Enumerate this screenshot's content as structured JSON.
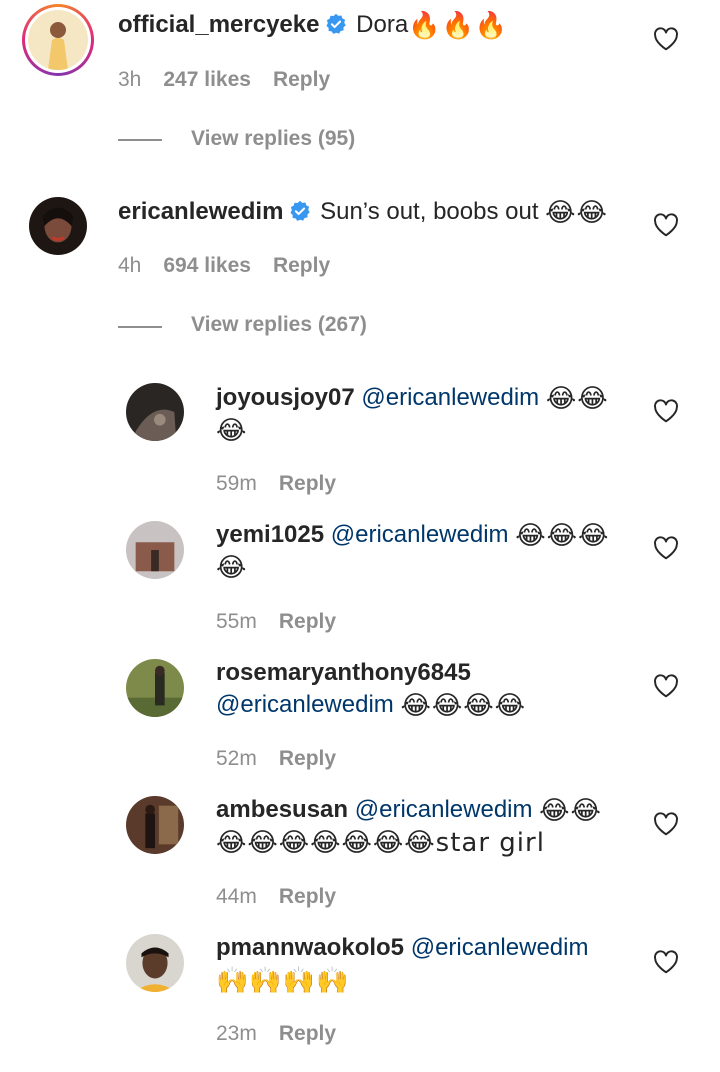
{
  "comments": [
    {
      "username": "official_mercyeke",
      "verified": true,
      "text": "Dora",
      "emoji": "🔥🔥🔥",
      "time": "3h",
      "likes": "247 likes",
      "reply": "Reply",
      "view_replies": "View replies (95)",
      "avatar_colors": [
        "#f3c86a",
        "#c89a3c"
      ]
    },
    {
      "username": "ericanlewedim",
      "verified": true,
      "text": "Sun’s out, boobs out",
      "emoji": "😂😂",
      "time": "4h",
      "likes": "694 likes",
      "reply": "Reply",
      "view_replies": "View replies (267)",
      "avatar_colors": [
        "#2b1d18",
        "#7a4a3a"
      ]
    }
  ],
  "replies": [
    {
      "username": "joyousjoy07",
      "mention": "@ericanlewedim",
      "emoji_line1": "😂😂",
      "line2": "😂",
      "time": "59m",
      "reply": "Reply",
      "avatar_colors": [
        "#2a2624",
        "#6b5d55"
      ]
    },
    {
      "username": "yemi1025",
      "mention": "@ericanlewedim",
      "emoji_line1": "😂😂😂",
      "line2": "😂",
      "time": "55m",
      "reply": "Reply",
      "avatar_colors": [
        "#b9b3b3",
        "#6b3f34"
      ]
    },
    {
      "username": "rosemaryanthony6845",
      "mention": "@ericanlewedim",
      "emoji_line1": "",
      "line2": "😂😂😂😂",
      "time": "52m",
      "reply": "Reply",
      "avatar_colors": [
        "#7e8a4a",
        "#3a3f25"
      ]
    },
    {
      "username": "ambesusan",
      "mention": "@ericanlewedim",
      "emoji_line1": "😂😂",
      "line2": "😂😂😂😂😂😂😂star girl",
      "time": "44m",
      "reply": "Reply",
      "avatar_colors": [
        "#5a3a2a",
        "#b07a5a"
      ]
    },
    {
      "username": "pmannwaokolo5",
      "mention": "@ericanlewedim",
      "emoji_line1": "",
      "line2": "🙌🙌🙌🙌",
      "time": "23m",
      "reply": "Reply",
      "avatar_colors": [
        "#c9c6c0",
        "#5b3b2a"
      ]
    }
  ],
  "colors": {
    "text": "#262626",
    "meta": "#8e8e8e",
    "mention": "#00376b",
    "verified": "#3897f0"
  },
  "icons": {
    "like": "heart-outline-icon",
    "verified": "verified-badge-icon"
  }
}
